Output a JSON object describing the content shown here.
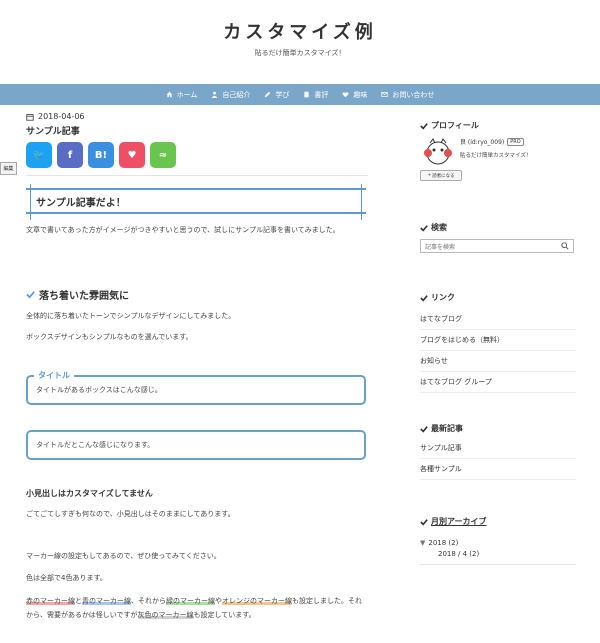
{
  "site": {
    "title": "カスタマイズ例",
    "description": "貼るだけ簡単カスタマイズ！"
  },
  "nav": [
    {
      "label": "ホーム",
      "icon": "home-icon"
    },
    {
      "label": "自己紹介",
      "icon": "person-icon"
    },
    {
      "label": "学び",
      "icon": "pencil-icon"
    },
    {
      "label": "書評",
      "icon": "book-icon"
    },
    {
      "label": "趣味",
      "icon": "heart-icon"
    },
    {
      "label": "お問い合わせ",
      "icon": "mail-icon"
    }
  ],
  "post": {
    "date": "2018-04-06",
    "title": "サンプル記事",
    "edit_label": "編集",
    "share": [
      {
        "label": "twitter",
        "glyph": "🐦",
        "color": "#1da1f2"
      },
      {
        "label": "facebook",
        "glyph": "f",
        "color": "#5a6dc4"
      },
      {
        "label": "hatena",
        "glyph": "B!",
        "color": "#3b8fe0"
      },
      {
        "label": "pocket",
        "glyph": "♥",
        "color": "#ee4f64"
      },
      {
        "label": "feed",
        "glyph": "≈",
        "color": "#6ac550"
      }
    ],
    "heading1": "サンプル記事だよ！",
    "para1": "文章で書いてあった方がイメージがつきやすいと思うので、試しにサンプル記事を書いてみました。",
    "heading2": "落ち着いた雰囲気に",
    "para2": "全体的に落ち着いたトーンでシンプルなデザインにしてみました。",
    "para3": "ボックスデザインもシンプルなものを選んでいます。",
    "box1_label": "タイトル",
    "box1_text": "タイトルがあるボックスはこんな感じ。",
    "box2_text": "タイトルだとこんな感じになります。",
    "heading3": "小見出しはカスタマイズしてません",
    "para4": "ごてごてしすぎも何なので、小見出しはそのままにしてあります。",
    "para5": "マーカー線の設定もしてあるので、ぜひ使ってみてください。",
    "para6": "色は全部で4色あります。",
    "marker_text": {
      "red": "赤のマーカー線",
      "and": "と",
      "blue": "青のマーカー線",
      "mid": "、それから",
      "green": "緑のマーカー線",
      "ya": "や",
      "orange": "オレンジのマーカー線",
      "tail1": "も設定しました。それから、需要があるかは怪しいですが",
      "gray": "灰色のマーカー線",
      "tail2": "も設定しています。"
    }
  },
  "sidebar": {
    "profile": {
      "heading": "プロフィール",
      "name": "良 (id:ryo_009)",
      "badge": "PRO",
      "desc": "貼るだけ簡単カスタマイズ！",
      "reader_button": "読者になる"
    },
    "search": {
      "heading": "検索",
      "placeholder": "記事を検索"
    },
    "links": {
      "heading": "リンク",
      "items": [
        "はてなブログ",
        "ブログをはじめる（無料）",
        "お知らせ",
        "はてなブログ グループ"
      ]
    },
    "recent": {
      "heading": "最新記事",
      "items": [
        "サンプル記事",
        "各種サンプル"
      ]
    },
    "archive": {
      "heading": "月別アーカイブ",
      "year": "2018 (2)",
      "month": "2018 / 4 (2)"
    }
  },
  "colors": {
    "accent": "#7aa7c9",
    "heading_blue": "#5b9bd5"
  }
}
